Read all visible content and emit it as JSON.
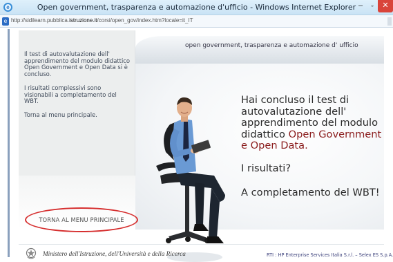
{
  "window": {
    "title": "Open government, trasparenza e automazione d'ufficio - Windows Internet Explorer",
    "controls": {
      "minimize": "–",
      "maximize": "▫",
      "close": "✕"
    }
  },
  "address": {
    "url_prefix": "http://sidilearn.pubblica.",
    "url_domain": "istruzione.it",
    "url_suffix": "/corsi/open_gov/index.htm?locale=it_IT"
  },
  "banner": {
    "text": "open government, trasparenza e automazione d' ufficio"
  },
  "left_panel": {
    "message": "Il test di autovalutazione dell' apprendimento del modulo didattico Open Government e Open Data si è concluso.",
    "results_note": "I risultati complessivi sono visionabili a completamento del WBT.",
    "return_note": "Torna al menu principale.",
    "menu_button": "TORNA AL MENU PRINCIPALE"
  },
  "main": {
    "headline_lead": "Hai concluso il test di autovalutazione dell' apprendimento del modulo didattico",
    "headline_highlight": "Open Government e Open Data.",
    "results_question": "I risultati?",
    "completion": "A completamento del WBT!"
  },
  "footer": {
    "ministry": "Ministero dell'Istruzione, dell'Università e della Ricerca",
    "rti": "RTI : HP Enterprise Services Italia S.r.l. – Selex ES S.p.A."
  },
  "colors": {
    "highlight": "#8a1b1b",
    "button_outline": "#d63030",
    "titlebar": "#c9e3f5"
  }
}
